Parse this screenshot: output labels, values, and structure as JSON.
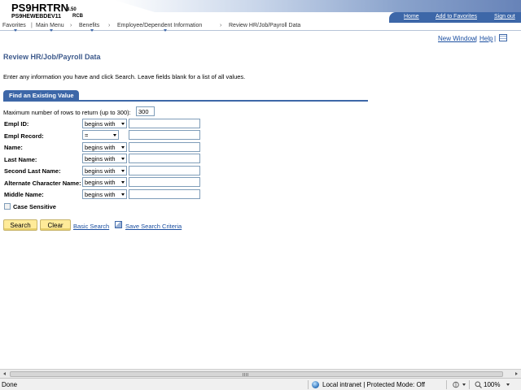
{
  "header": {
    "app_name": "PS9HRTRN",
    "app_version": "8.50",
    "db_name": "PS9HEWEBDEV11",
    "db_suffix": "RCB",
    "links": [
      "Home",
      "Add to Favorites",
      "Sign out"
    ]
  },
  "breadcrumb": {
    "items": [
      "Favorites",
      "Main Menu",
      "Benefits",
      "Employee/Dependent Information",
      "Review HR/Job/Payroll Data"
    ],
    "separator": "›"
  },
  "utilities": {
    "new_window": "New Window",
    "separator": "|",
    "help": "Help",
    "icon": "customize-page-icon"
  },
  "page": {
    "title": "Review HR/Job/Payroll Data",
    "instructions": "Enter any information you have and click Search. Leave fields blank for a list of all values."
  },
  "tab": {
    "label": "Find an Existing Value"
  },
  "max_rows": {
    "label": "Maximum number of rows to return (up to 300):",
    "value": "300"
  },
  "fields": [
    {
      "label": "Empl ID:",
      "operator": "begins with",
      "value": ""
    },
    {
      "label": "Empl Record:",
      "operator": "=",
      "value": ""
    },
    {
      "label": "Name:",
      "operator": "begins with",
      "value": ""
    },
    {
      "label": "Last Name:",
      "operator": "begins with",
      "value": ""
    },
    {
      "label": "Second Last Name:",
      "operator": "begins with",
      "value": ""
    },
    {
      "label": "Alternate Character Name:",
      "operator": "begins with",
      "value": ""
    },
    {
      "label": "Middle Name:",
      "operator": "begins with",
      "value": ""
    }
  ],
  "case_sensitive": {
    "label": "Case Sensitive",
    "checked": false
  },
  "actions": {
    "search": "Search",
    "clear": "Clear",
    "basic_search": "Basic Search",
    "save_search": "Save Search Criteria"
  },
  "statusbar": {
    "status": "Done",
    "zone": "Local intranet | Protected Mode: Off",
    "zoom": "100%"
  },
  "colors": {
    "brand_blue": "#3d67a8",
    "title_blue": "#3d5a8c",
    "button_yellow": "#ffeb99",
    "link_blue": "#1a4ea0"
  }
}
